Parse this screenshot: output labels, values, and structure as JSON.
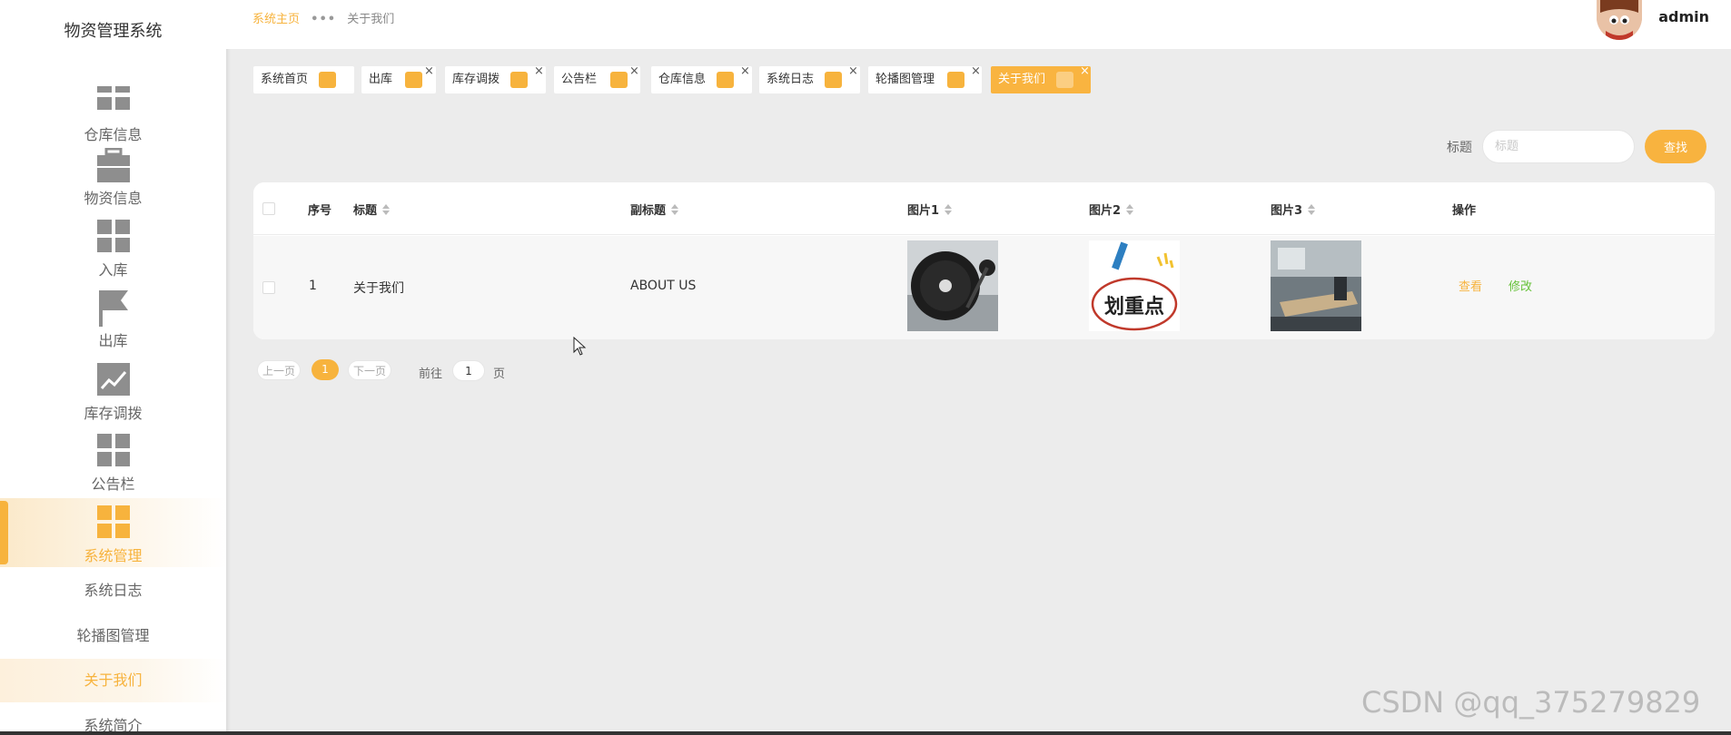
{
  "app": {
    "title": "物资管理系统"
  },
  "sidebar": {
    "items": [
      {
        "label": "仓库信息",
        "icon": "grid-icon"
      },
      {
        "label": "物资信息",
        "icon": "briefcase-icon"
      },
      {
        "label": "入库",
        "icon": "grid-icon"
      },
      {
        "label": "出库",
        "icon": "flag-icon"
      },
      {
        "label": "库存调拨",
        "icon": "trend-chart-icon"
      },
      {
        "label": "公告栏",
        "icon": "grid-icon"
      },
      {
        "label": "系统管理",
        "icon": "grid-icon",
        "active": true
      }
    ],
    "sub_items": [
      {
        "label": "系统日志"
      },
      {
        "label": "轮播图管理"
      },
      {
        "label": "关于我们",
        "active": true
      },
      {
        "label": "系统简介"
      }
    ]
  },
  "header": {
    "breadcrumb_home": "系统主页",
    "breadcrumb_sep": "•••",
    "breadcrumb_current": "关于我们",
    "username": "admin"
  },
  "tags": [
    {
      "label": "系统首页",
      "closable": false
    },
    {
      "label": "出库",
      "closable": true
    },
    {
      "label": "库存调拨",
      "closable": true
    },
    {
      "label": "公告栏",
      "closable": true
    },
    {
      "label": "仓库信息",
      "closable": true
    },
    {
      "label": "系统日志",
      "closable": true
    },
    {
      "label": "轮播图管理",
      "closable": true
    },
    {
      "label": "关于我们",
      "closable": true,
      "active": true
    }
  ],
  "search": {
    "label": "标题",
    "placeholder": "标题",
    "button": "查找"
  },
  "table": {
    "columns": [
      "序号",
      "标题",
      "副标题",
      "图片1",
      "图片2",
      "图片3",
      "操作"
    ],
    "rows": [
      {
        "index": "1",
        "title": "关于我们",
        "subtitle": "ABOUT US",
        "img2_text": "划重点",
        "actions": [
          "查看",
          "修改"
        ]
      }
    ]
  },
  "pagination": {
    "prev": "上一页",
    "current": "1",
    "next": "下一页",
    "goto": "前往",
    "goto_value": "1",
    "page_unit": "页"
  },
  "close_glyph": "×",
  "watermark": "CSDN @qq_375279829",
  "colors": {
    "accent": "#f7b33d",
    "edit": "#67c23a"
  }
}
